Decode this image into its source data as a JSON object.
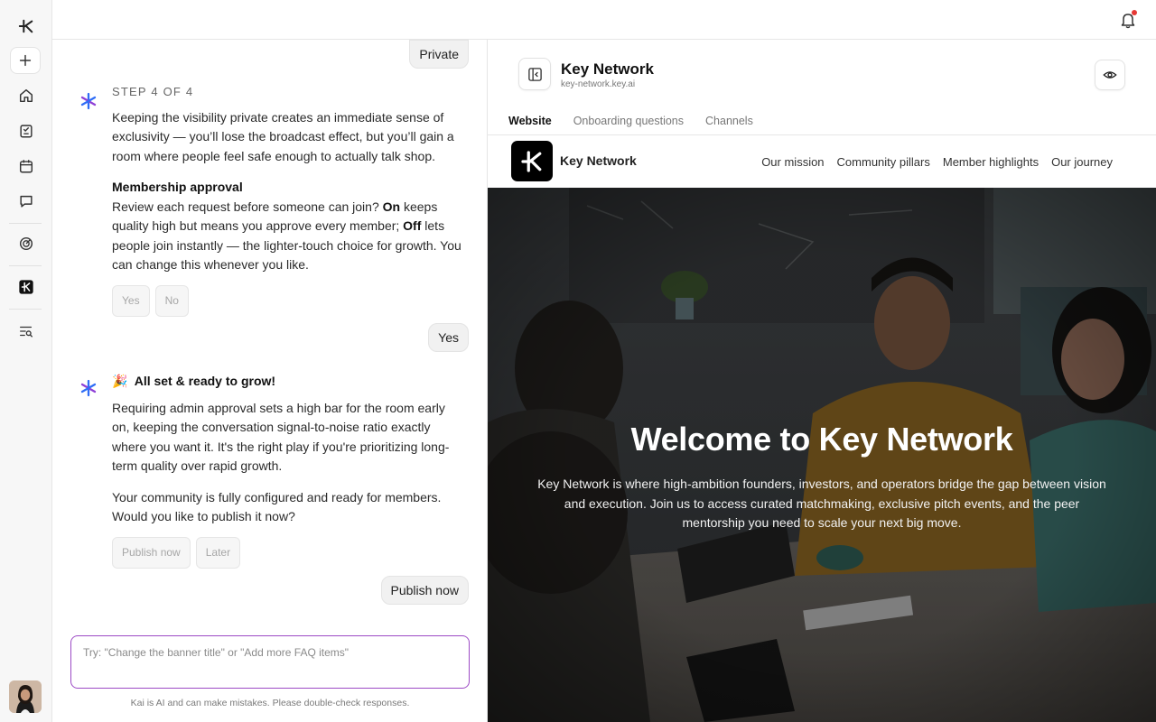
{
  "rail": {
    "items": [
      "logo-icon",
      "new-icon",
      "home-icon",
      "tasks-icon",
      "calendar-icon",
      "chat-icon",
      "analytics-icon",
      "key-app-icon",
      "search-list-icon"
    ]
  },
  "chat": {
    "bubble_private": "Private",
    "step_label": "STEP 4 OF 4",
    "msg1": "Keeping the visibility private creates an immediate sense of exclusivity — you’ll lose the broadcast effect, but you’ll gain a room where people feel safe enough to actually talk shop.",
    "approval_heading": "Membership approval",
    "approval_text_a": "Review each request before someone can join? ",
    "approval_on": "On",
    "approval_text_b": " keeps quality high but means you approve every member; ",
    "approval_off": "Off",
    "approval_text_c": " lets people join instantly — the lighter-touch choice for growth. You can change this whenever you like.",
    "chip_yes": "Yes",
    "chip_no": "No",
    "bubble_yes": "Yes",
    "ready_emoji": "🎉",
    "ready_heading": "All set & ready to grow!",
    "msg2": "Requiring admin approval sets a high bar for the room early on, keeping the conversation signal-to-noise ratio exactly where you want it. It's the right play if you're prioritizing long-term quality over rapid growth.",
    "msg3": "Your community is fully configured and ready for members. Would you like to publish it now?",
    "chip_publish": "Publish now",
    "chip_later": "Later",
    "bubble_publish": "Publish now",
    "composer_placeholder": "Try: \"Change the banner title\" or \"Add more FAQ items\"",
    "disclaimer": "Kai is AI and can make mistakes. Please double-check responses."
  },
  "preview": {
    "title": "Key Network",
    "subtitle": "key-network.key.ai",
    "tabs": [
      "Website",
      "Onboarding questions",
      "Channels"
    ],
    "active_tab": "Website",
    "site": {
      "brand": "Key Network",
      "nav": [
        "Our mission",
        "Community pillars",
        "Member highlights",
        "Our journey"
      ],
      "hero_title": "Welcome to Key Network",
      "hero_text": "Key Network is where high-ambition founders, investors, and operators bridge the gap between vision and execution. Join us to access curated matchmaking, exclusive pitch events, and the peer mentorship you need to scale your next big move."
    }
  },
  "colors": {
    "accent": "#9c4ac5",
    "kai_blue": "#2f6df6",
    "kai_purple": "#8e3fd6",
    "notification": "#e53935"
  }
}
